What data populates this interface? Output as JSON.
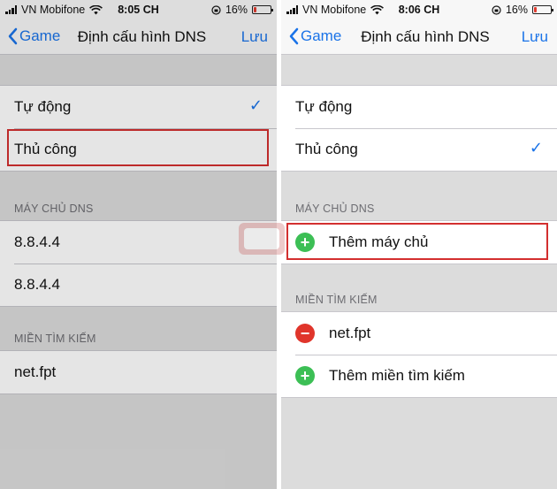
{
  "colors": {
    "accent": "#1a73e8",
    "highlight": "#d32f2f",
    "add": "#3cbf55",
    "remove": "#e0352b"
  },
  "left": {
    "status": {
      "carrier": "VN Mobifone",
      "time": "8:05 CH",
      "battery": "16%",
      "battery_level": 0.16
    },
    "nav": {
      "back": "Game",
      "title": "Định cấu hình DNS",
      "save": "Lưu"
    },
    "mode": {
      "options": [
        "Tự động",
        "Thủ công"
      ],
      "selected": "Tự động"
    },
    "dns": {
      "header": "MÁY CHỦ DNS",
      "servers": [
        "8.8.4.4",
        "8.8.4.4"
      ]
    },
    "search": {
      "header": "MIỀN TÌM KIẾM",
      "domains": [
        "net.fpt"
      ]
    }
  },
  "right": {
    "status": {
      "carrier": "VN Mobifone",
      "time": "8:06 CH",
      "battery": "16%",
      "battery_level": 0.16
    },
    "nav": {
      "back": "Game",
      "title": "Định cấu hình DNS",
      "save": "Lưu"
    },
    "mode": {
      "options": [
        "Tự động",
        "Thủ công"
      ],
      "selected": "Thủ công"
    },
    "dns": {
      "header": "MÁY CHỦ DNS",
      "add_label": "Thêm máy chủ"
    },
    "search": {
      "header": "MIỀN TÌM KIẾM",
      "domains": [
        "net.fpt"
      ],
      "add_label": "Thêm miền tìm kiếm"
    }
  }
}
